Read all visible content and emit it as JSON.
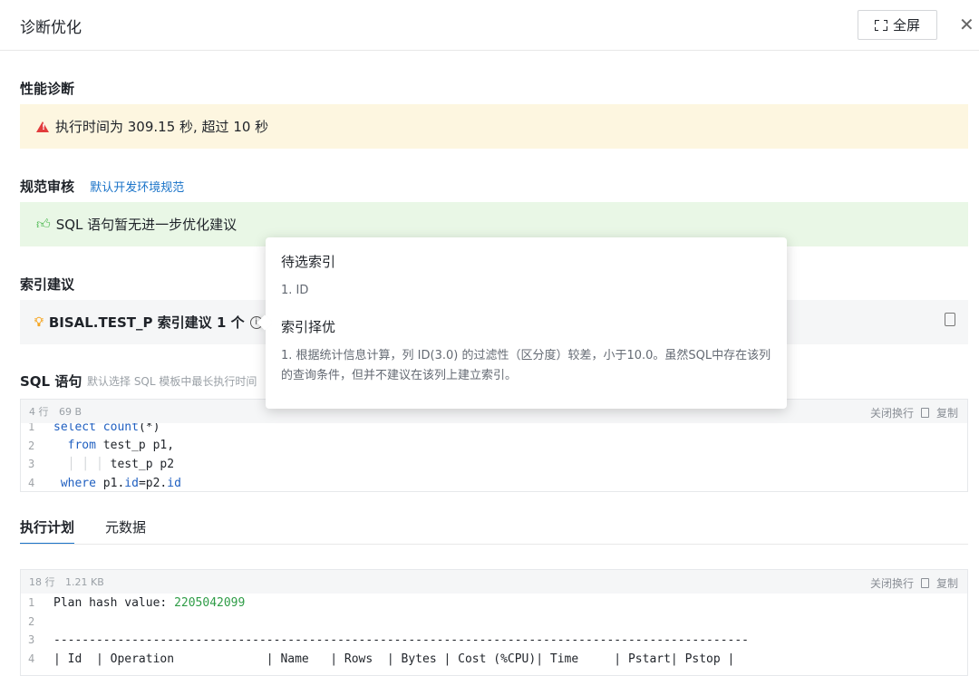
{
  "header": {
    "title": "诊断优化",
    "fullscreen_label": "全屏"
  },
  "performance": {
    "title": "性能诊断",
    "alert": "执行时间为 309.15 秒, 超过 10 秒"
  },
  "review": {
    "title": "规范审核",
    "link": "默认开发环境规范",
    "alert": "SQL 语句暂无进一步优化建议"
  },
  "index": {
    "title": "索引建议",
    "card_text": "BISAL.TEST_P 索引建议 1 个"
  },
  "sql": {
    "title": "SQL 语句",
    "hint": "默认选择 SQL 模板中最长执行时间",
    "meta_lines": "4 行",
    "meta_size": "69 B",
    "wrap_label": "关闭换行",
    "copy_label": "复制",
    "lines": [
      {
        "n": "1",
        "parts": [
          {
            "t": "select",
            "c": "kw"
          },
          {
            "t": " "
          },
          {
            "t": "count",
            "c": "kw"
          },
          {
            "t": "(*)"
          }
        ]
      },
      {
        "n": "2",
        "parts": [
          {
            "t": "  "
          },
          {
            "t": "from",
            "c": "kw"
          },
          {
            "t": " test_p p1,"
          }
        ]
      },
      {
        "n": "3",
        "parts": [
          {
            "t": "  "
          },
          {
            "t": "│ │ │",
            "c": "guide"
          },
          {
            "t": " test_p p2"
          }
        ]
      },
      {
        "n": "4",
        "parts": [
          {
            "t": " "
          },
          {
            "t": "where",
            "c": "kw"
          },
          {
            "t": " p1."
          },
          {
            "t": "id",
            "c": "kw"
          },
          {
            "t": "=p2."
          },
          {
            "t": "id",
            "c": "kw"
          }
        ]
      }
    ]
  },
  "tabs": [
    {
      "label": "执行计划",
      "active": true
    },
    {
      "label": "元数据",
      "active": false
    }
  ],
  "plan": {
    "meta_lines": "18 行",
    "meta_size": "1.21 KB",
    "wrap_label": "关闭换行",
    "copy_label": "复制",
    "lines": [
      {
        "n": "1",
        "parts": [
          {
            "t": "Plan hash value: "
          },
          {
            "t": "2205042099",
            "c": "num"
          }
        ]
      },
      {
        "n": "2",
        "parts": [
          {
            "t": ""
          }
        ]
      },
      {
        "n": "3",
        "parts": [
          {
            "t": "--------------------------------------------------------------------------------------------------"
          }
        ]
      },
      {
        "n": "4",
        "parts": [
          {
            "t": "| Id  | Operation             | Name   | Rows  | Bytes | Cost (%CPU)| Time     | Pstart| Pstop |"
          }
        ]
      }
    ]
  },
  "tooltip": {
    "h1": "待选索引",
    "t1": "1. ID",
    "h2": "索引择优",
    "t2": "1. 根据统计信息计算，列 ID(3.0) 的过滤性（区分度）较差，小于10.0。虽然SQL中存在该列的查询条件，但并不建议在该列上建立索引。"
  }
}
